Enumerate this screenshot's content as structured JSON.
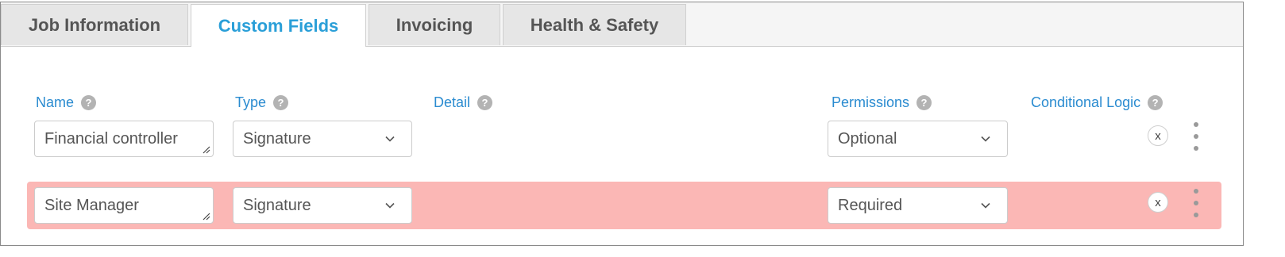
{
  "tabs": [
    {
      "label": "Job Information",
      "active": false
    },
    {
      "label": "Custom Fields",
      "active": true
    },
    {
      "label": "Invoicing",
      "active": false
    },
    {
      "label": "Health & Safety",
      "active": false
    }
  ],
  "columns": {
    "name": "Name",
    "type": "Type",
    "detail": "Detail",
    "permissions": "Permissions",
    "conditional_logic": "Conditional Logic"
  },
  "help_glyph": "?",
  "rows": [
    {
      "name": "Financial controller",
      "type": "Signature",
      "permission": "Optional",
      "remove_label": "x",
      "highlighted": false
    },
    {
      "name": "Site Manager",
      "type": "Signature",
      "permission": "Required",
      "remove_label": "x",
      "highlighted": true
    }
  ],
  "colors": {
    "accent": "#2a9fd8",
    "label_blue": "#2a8bd0",
    "row_highlight": "#fbb7b5"
  }
}
